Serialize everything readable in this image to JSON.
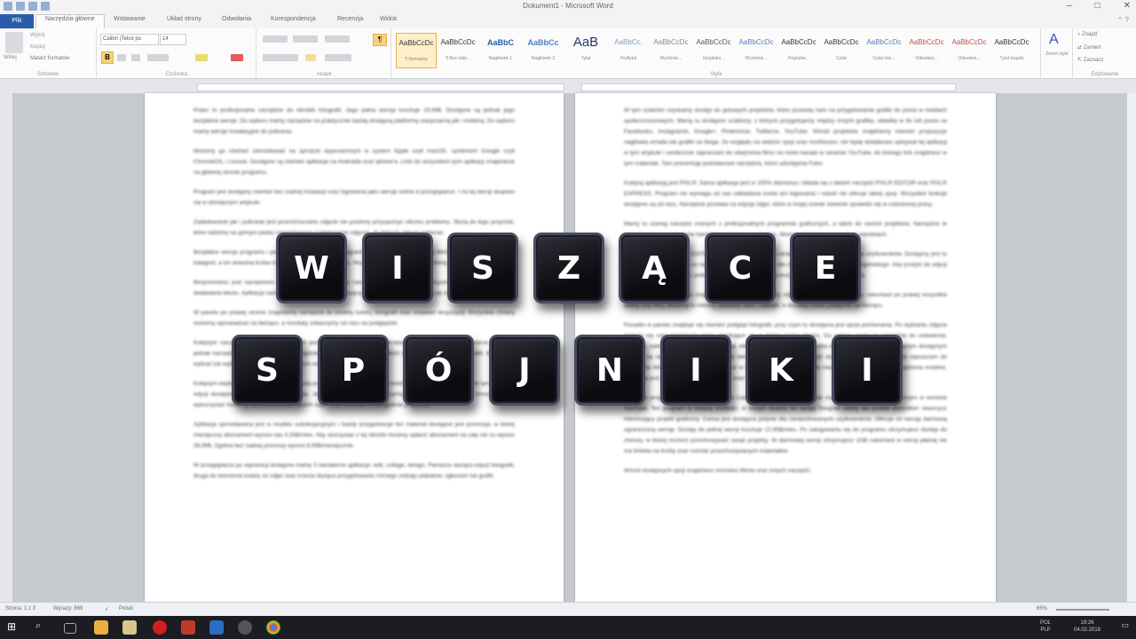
{
  "window": {
    "title": "Dokument1 - Microsoft Word",
    "controls": [
      "–",
      "□",
      "✕"
    ]
  },
  "tabs": {
    "file": "Plik",
    "items": [
      "Narzędzia główne",
      "Wstawianie",
      "Układ strony",
      "Odwołania",
      "Korespondencja",
      "Recenzja",
      "Widok"
    ]
  },
  "ribbon": {
    "clipboard": {
      "paste": "Wklej",
      "cut": "Wytnij",
      "copy": "Kopiuj",
      "format_painter": "Malarz formatów",
      "label": "Schowek"
    },
    "font": {
      "name": "Calibri (Tekst po",
      "size": "14",
      "label": "Czcionka"
    },
    "paragraph": {
      "label": "Akapit"
    },
    "styles": {
      "label": "Style",
      "items": [
        {
          "preview": "AaBbCcDc",
          "name": "¶ Normalny"
        },
        {
          "preview": "AaBbCcDc",
          "name": "¶ Bez odst..."
        },
        {
          "preview": "AaBbC",
          "name": "Nagłówek 1"
        },
        {
          "preview": "AaBbCc",
          "name": "Nagłówek 2"
        },
        {
          "preview": "AaB",
          "name": "Tytuł"
        },
        {
          "preview": "AaBbCc.",
          "name": "Podtytuł"
        },
        {
          "preview": "AaBbCcDc",
          "name": "Wyróżnie..."
        },
        {
          "preview": "AaBbCcDc",
          "name": "Uwydatni..."
        },
        {
          "preview": "AaBbCcDc",
          "name": "Wyróżnie..."
        },
        {
          "preview": "AaBbCcDc",
          "name": "Pogrubie..."
        },
        {
          "preview": "AaBbCcDc",
          "name": "Cytat"
        },
        {
          "preview": "AaBbCcDc",
          "name": "Cytat inte..."
        },
        {
          "preview": "AaBbCcDc",
          "name": "Odwołani..."
        },
        {
          "preview": "AaBbCcDc",
          "name": "Odwołani..."
        },
        {
          "preview": "AaBbCcDc",
          "name": "Tytuł książki"
        }
      ],
      "change": "Zmień style"
    },
    "editing": {
      "find": "Znajdź",
      "replace": "Zamień",
      "select": "Zaznacz",
      "label": "Edytowanie"
    }
  },
  "document": {
    "left_page": [
      "Polarr to profesjonalne narzędzie do obróbki fotografii. Jego pełna wersja kosztuje 19,99$. Dostępne są jednak jego bezpłatne wersje. Do wyboru mamy narzędzie na praktycznie każdą dostępną platformę stacjonarną jak i mobilną. Do wyboru mamy wersje instalacyjne do pobrania.",
      "Możemy go również zainstalować na sprzęcie wyposażonym w system Apple czyli macOS, systemem Google czyli ChromeOS, i Linuxie. Dostępne są również aplikacje na Androida oraz iphone'a. Linki do wszystkich tych aplikacji znajdziecie na głównej stronie programu.",
      "Program jest dostępny również bez żadnej instalacji oraz logowania jako wersja online w przeglądarce. I na tej wersji skupiam się w dzisiejszym artykule.",
      "Zadedowanie jak i pobranie jest przeróżnorodne zdjęcie nie powinny przysporzyć nikomu problemu. Służą do tego przyciski, które widzimy na górnym pasku narzędziowym (zaledowanie zdjęcia), do których zdjęcie pobierać.",
      "Bezpłatne wersje programu i pełne zestawy funkcji nie są ograniczone. Do dyspozycji mamy filtrów powiązanych z każdą z kategorii, a ich dowolna liczba może być dostępna do wyboru. Możemy także filtry jak i różne efekty przenosić do programu.",
      "Bezpośrednio pod narzędziem Filtrami znajdziemy kolejne narzędzia i ustawienia oraz przycinanie fotografii oraz opcje dodawania tekstu. Aplikacja sama potrafi wykryć twarz znajdującą się na zdjęciu, co umożliwia jej szybką i łatwą obróbkę.",
      "W panelu po prawej stronie znajdziemy narzędzia do korekty koloru, fotografii oraz ustawień ekspozycji. Wszystkie zmiany możemy wprowadzać na bieżąco, a rezultaty zobaczymy od razu na podglądzie.",
      "Kolejnym narzędziem do obróbki fotografii jest Fotor. Zdjęcia możemy obrabiać bezpośrednio w przeglądarce. Program jednak narzędzia płatne. W panelu tym znajdziemy również podgląd wszystkich dokonanych zmian na fotografii. Możemy tu wybrać lub wyłączyć każdą z wprowadzonych na zdjęciu zmian.",
      "Kolejnym edytorem online, któremu się dzisiaj przyjrzymy jest Fotor. Od poprzednika różni się on między innymi tym, że opcje edycji dostępne są jedynie po zalogowaniu. Jednak oraz z rejestracją otrzymujemy 50MB powierzchni w chmurze, którą wykorzystać możemy na przechowanie swoich zdjęć oraz dowolnych w programie projektów.",
      "Aplikacja sprzedawana jest w modelu subskrypcyjnym i każdy przygotowuje ten materiał dostępne jest promocja, w której miesięczny abonament wynosi nas 3,33$/mies. Aby skorzystać z tej obniżki musimy opłacić abonament na cały rok co wynosi 39,99$. Ogólna bez żadnej promocji wynosi 8,99$/miesięcznie.",
      "W przeglądarce po rejestracji dostępne mamy 3 niezależne aplikacje: edit, collage, design. Pierwsza służąca edycji fotografii, druga do tworzenia kolaży ze zdjęć oraz trzecia służąca przygotowaniu różnego rodzaju plakatów, ogłoszeń lub grafik."
    ],
    "right_page": [
      "W tym ostatnim uzyskamy dostęp do gotowych projektów, które pozwolą nam na przygotowanie grafiki do posta w mediach społecznościowych. Mamy tu dostępne szablony, z których przygotujemy między innymi grafikę, okładkę w tle lub posta na Facebooku, Instagramie, Google+, Pintereście, Twitterze, YouTube. Wśród projektów znajdziemy również propozycje nagłówka emaila lub grafiki na bloga. Ze względu na wielość opcji oraz możliwości, nie będę dodatkowo opisywał tej aplikacji w tym artykule i serdecznie zapraszam do obejrzenia filmu na moim kanale w serwisie YouTube, do którego link znajdziesz w tym materiale. Tam prezentuję podstawowe narzędzia, które udostępnia Fotor.",
      "Kolejną aplikacją jest PIXLR. Sama aplikacja jest w 100% darmowa i składa się z dwóch narzędzi PIXLR EDITOR oraz PIXLR EXPRESS. Program nie wymaga od nas zakładania konta ani logowania i nawet nie oferuje takiej opcji. Wszystkie funkcje dostępne są od razu. Narzędzie pozwala na edycję zdjęć, które w mojej ocenie świetnie sprawdzi się w codziennej pracy.",
      "Mamy tu szereg narzędzi znanych z profesjonalnych programów graficznych, a także do swoich projektów. Narzędzia te pozwolą nam na wykonanie bardziej zaawansowanych prac. Możemy również pracować na warstwach.",
      "Kolejne narzędzie PIXLR EDITOR to narzędzie prostsze w obsłudze i bardziej przyjazne dla użytkowników. Dostępny jest tu interfejs w języku polskim co na pewno będzie ułatwieniem dla osób nie znających języka angielskiego. Aby przejść do edycji wystarczy wczytać zdjęcie, potem bardzo łatwo dostępne są wszystkie podstawowe narzędzia.",
      "W panelu po lewej stronie znajdziemy narzędzia do korekty zdjęć, a w górnej części menu, natomiast po prawej wszystkie efekty oraz filtry. Możemy tu również dodawać tekst i naklejki, a rezultaty zmian podejrzeć na bieżąco.",
      "Ponadto w panelu znajduje się również podgląd fotografii, przy czym tu dostępna jest opcja porównania. Po wybraniu zdjęcia pojawia się nam przejrzyste menu znajdujące się w dolnej części ekranu. Do wyboru mamy tu narzędzia do ustawienia, efektami, naklejkami (możemy tu dodać np. efekty wybuchu, dymu, serduszka lub flag), a także ramki. Kolejnym dostępnym opcjami są ramki, naklejki oraz narzędzie tekstowe. Jeśli chcesz zobaczyć działanie programu w praktyce zapraszam do obejrzenia filmu, do którego link znajdziesz w tym artykule. PIXLR posiada również wersję aplikacji na urządzenia mobilne. Dostępny jest dla Androida w Google Play oraz iphone'a w AppStore.",
      "Kolejnym programem do edycji grafiki jest Canva. Opisu tego programu nie znajdziesz w filmie zamieszczonym w serwisie YouTube. Ten program to kolejny kombajn, w którym dodasz do swojej fotografii efekty ale przede wszystkim stworzysz interesujący projekt graficzny. Canva jest dostępna jedynie dla zarejestrowanych użytkowników. Oferuje on wersję darmową ograniczoną wersję. Dostęp do pełnej wersji kosztuje 12,95$/mies. Po zalogowaniu się do programu otrzymujesz dostęp do chmury, w której możesz przechowywać swoje projekty. W darmowej wersji otrzymujesz 1GB natomiast w wersji płatnej nie ma limitów na liczbę oraz rozmiar przechowywanych materiałów.",
      "Wśród dostępnych opcji znajdziesz mnóstwo filtrów oraz innych narzędzi."
    ]
  },
  "overlay": {
    "line1": [
      "W",
      "I",
      "S",
      "Z",
      "Ą",
      "C",
      "E"
    ],
    "line2": [
      "S",
      "P",
      "Ó",
      "J",
      "N",
      "I",
      "K",
      "I"
    ]
  },
  "statusbar": {
    "page": "Strona: 1 z 3",
    "words": "Wyrazy: 869",
    "language": "Polski",
    "zoom": "65%"
  },
  "taskbar": {
    "lang_top": "POL",
    "lang_bottom": "PLP",
    "time": "19:26",
    "date": "04.02.2018"
  },
  "colors": {
    "file_tab": "#2a5caa",
    "key_face": "#0b0b10",
    "key_border": "#4a4c62",
    "taskbar": "#1c1c22"
  }
}
